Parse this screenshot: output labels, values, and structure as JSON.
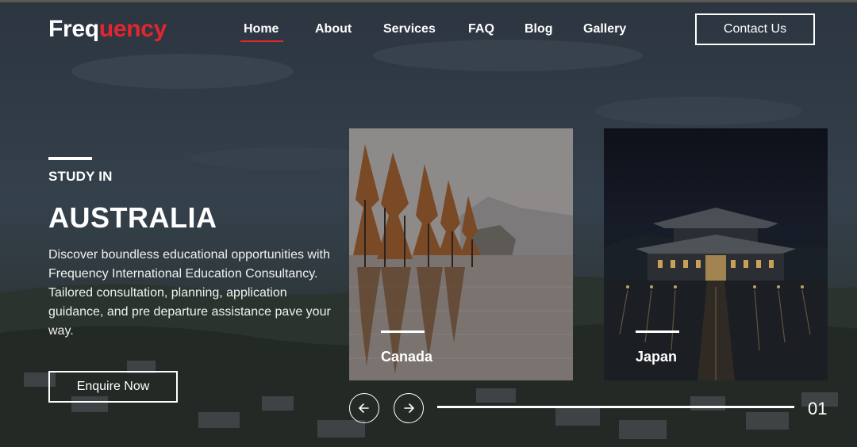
{
  "brand": {
    "name_prefix": "Freq",
    "name_accent": "uency",
    "accent_color": "#e3262d"
  },
  "nav": {
    "items": [
      {
        "label": "Home",
        "active": true
      },
      {
        "label": "About",
        "active": false
      },
      {
        "label": "Services",
        "active": false
      },
      {
        "label": "FAQ",
        "active": false
      },
      {
        "label": "Blog",
        "active": false
      },
      {
        "label": "Gallery",
        "active": false
      }
    ],
    "contact_label": "Contact Us"
  },
  "hero": {
    "eyebrow": "STUDY IN",
    "headline": "AUSTRALIA",
    "description": "Discover boundless educational opportunities with Frequency International Education Consultancy. Tailored consultation, planning, application guidance, and pre departure assistance pave your way.",
    "cta_label": "Enquire Now"
  },
  "destinations": [
    {
      "name": "Canada"
    },
    {
      "name": "Japan"
    }
  ],
  "slider": {
    "counter": "01",
    "progress": 1.0,
    "prev_icon": "arrow-left-icon",
    "next_icon": "arrow-right-icon"
  }
}
